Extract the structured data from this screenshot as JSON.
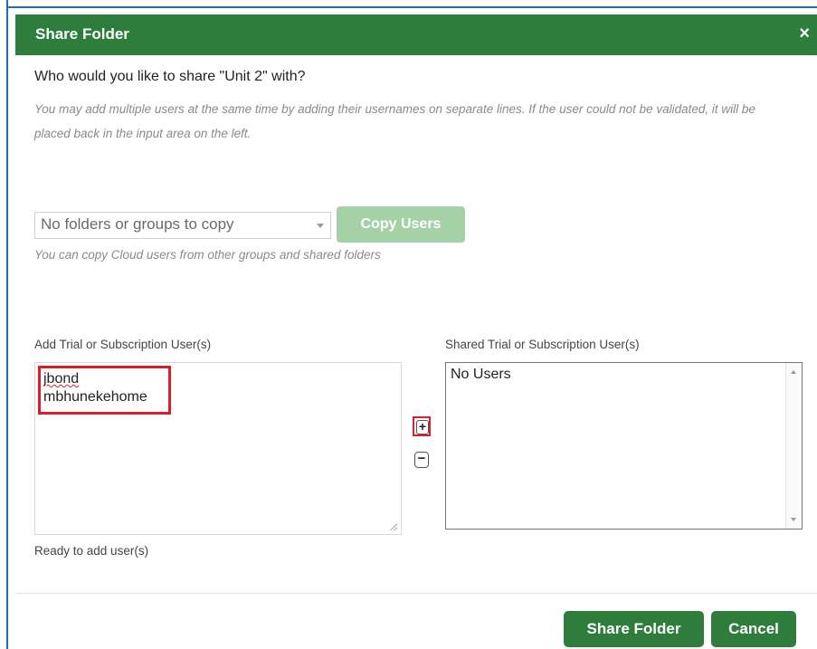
{
  "dialog": {
    "title": "Share Folder",
    "close_glyph": "×",
    "question": "Who would you like to share \"Unit 2\" with?",
    "help_text": "You may add multiple users at the same time by adding their usernames on separate lines. If the user could not be validated, it will be placed back in the input area on the left."
  },
  "copy_section": {
    "select_value": "No folders or groups to copy",
    "copy_button": "Copy Users",
    "help_text": "You can copy Cloud users from other groups and shared folders"
  },
  "add_users": {
    "label": "Add Trial or Subscription User(s)",
    "entries": [
      "jbond",
      "mbhunekehome"
    ],
    "status": "Ready to add user(s)"
  },
  "shared_users": {
    "label": "Shared Trial or Subscription User(s)",
    "items": [
      "No Users"
    ]
  },
  "transfer": {
    "add_glyph": "+",
    "remove_glyph": "−"
  },
  "footer": {
    "share_button": "Share Folder",
    "cancel_button": "Cancel"
  },
  "colors": {
    "header_green": "#2e7d3c",
    "disabled_green": "#a5d1a7",
    "highlight_red": "#d61f2a",
    "frame_blue": "#1b6fc2"
  }
}
